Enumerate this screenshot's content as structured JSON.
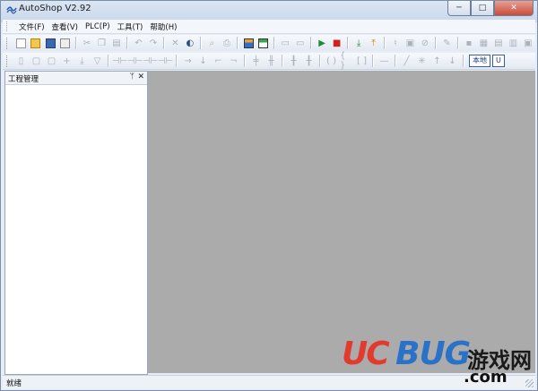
{
  "window": {
    "title": "AutoShop V2.92",
    "controls": {
      "minimize": "─",
      "maximize": "□",
      "close": "✕"
    }
  },
  "menubar": {
    "items": [
      {
        "label": "文件(F)"
      },
      {
        "label": "查看(V)"
      },
      {
        "label": "PLC(P)"
      },
      {
        "label": "工具(T)"
      },
      {
        "label": "帮助(H)"
      }
    ]
  },
  "toolbar1": {
    "icons": [
      "new-file-icon",
      "open-folder-icon",
      "save-icon",
      "save-all-icon",
      "cut-icon",
      "copy-icon",
      "paste-icon",
      "undo-icon",
      "redo-icon",
      "delete-icon",
      "find-icon",
      "print-preview-icon",
      "print-icon",
      "ladder-view-icon",
      "instruction-view-icon",
      "comment-icon",
      "comment-edit-icon",
      "run-icon",
      "stop-icon",
      "download-icon",
      "upload-icon",
      "monitor-icon",
      "monitor-edit-icon",
      "force-icon",
      "write-icon",
      "device-icon",
      "device-table-icon",
      "cross-ref-icon",
      "settings-icon"
    ]
  },
  "toolbar2": {
    "local_label": "本地",
    "u_label": "U"
  },
  "side_panel": {
    "title": "工程管理",
    "pin": "ᛘ",
    "close": "✕"
  },
  "statusbar": {
    "text": "就绪"
  },
  "watermark": {
    "uc": "UC",
    "bug": "BUG",
    "cn": "游戏网",
    "com": ".com"
  },
  "colors": {
    "workspace": "#ababab",
    "accent_red": "#e23b2e",
    "accent_blue": "#2a72c8"
  }
}
